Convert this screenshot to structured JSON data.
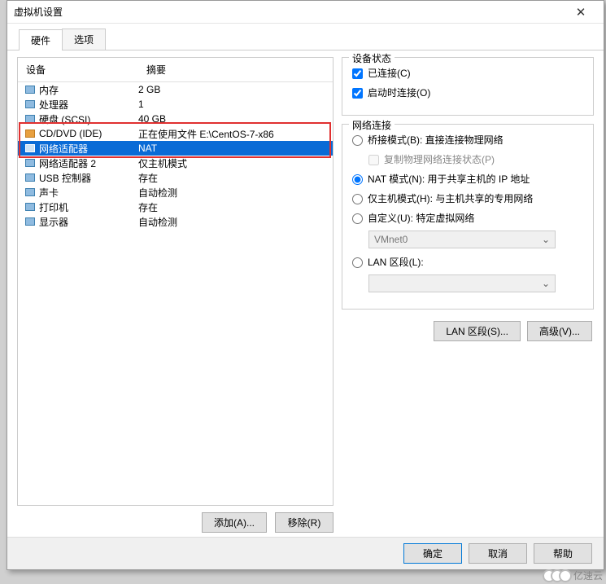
{
  "title": "虚拟机设置",
  "tabs": [
    "硬件",
    "选项"
  ],
  "columns": {
    "name": "设备",
    "summary": "摘要"
  },
  "devices": [
    {
      "icon": "memory-icon",
      "name": "内存",
      "summary": "2 GB"
    },
    {
      "icon": "cpu-icon",
      "name": "处理器",
      "summary": "1"
    },
    {
      "icon": "disk-icon",
      "name": "硬盘 (SCSI)",
      "summary": "40 GB"
    },
    {
      "icon": "cd-icon",
      "name": "CD/DVD (IDE)",
      "summary": "正在使用文件 E:\\CentOS-7-x86"
    },
    {
      "icon": "nic-icon",
      "name": "网络适配器",
      "summary": "NAT",
      "selected": true
    },
    {
      "icon": "nic-icon",
      "name": "网络适配器 2",
      "summary": "仅主机模式"
    },
    {
      "icon": "usb-icon",
      "name": "USB 控制器",
      "summary": "存在"
    },
    {
      "icon": "sound-icon",
      "name": "声卡",
      "summary": "自动检测"
    },
    {
      "icon": "printer-icon",
      "name": "打印机",
      "summary": "存在"
    },
    {
      "icon": "display-icon",
      "name": "显示器",
      "summary": "自动检测"
    }
  ],
  "leftButtons": {
    "add": "添加(A)...",
    "remove": "移除(R)"
  },
  "status": {
    "legend": "设备状态",
    "connected": "已连接(C)",
    "connectOnPower": "启动时连接(O)"
  },
  "net": {
    "legend": "网络连接",
    "bridge": "桥接模式(B): 直接连接物理网络",
    "replicate": "复制物理网络连接状态(P)",
    "nat": "NAT 模式(N): 用于共享主机的 IP 地址",
    "host": "仅主机模式(H): 与主机共享的专用网络",
    "custom": "自定义(U): 特定虚拟网络",
    "vmnet": "VMnet0",
    "lan": "LAN 区段(L):",
    "lanCombo": "",
    "lanBtn": "LAN 区段(S)...",
    "advBtn": "高级(V)..."
  },
  "bottom": {
    "ok": "确定",
    "cancel": "取消",
    "help": "帮助"
  },
  "watermark": "亿速云"
}
